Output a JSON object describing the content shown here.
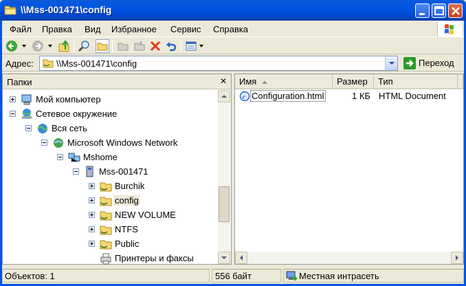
{
  "window": {
    "title": "\\\\Mss-001471\\config",
    "icons": [
      "folder-icon",
      "minimize-icon",
      "maximize-icon",
      "close-icon"
    ]
  },
  "menu": {
    "items": [
      "Файл",
      "Правка",
      "Вид",
      "Избранное",
      "Сервис",
      "Справка"
    ]
  },
  "toolbar": {
    "icons": [
      "back-icon",
      "forward-icon",
      "up-icon",
      "search-icon",
      "folders-icon",
      "move-to-icon",
      "copy-to-icon",
      "delete-icon",
      "undo-icon",
      "views-icon"
    ]
  },
  "address": {
    "label": "Адрес:",
    "value": "\\\\Mss-001471\\config",
    "go_label": "Переход"
  },
  "folders": {
    "title": "Папки",
    "items": [
      {
        "label": "Мой компьютер",
        "icon": "my-computer-icon",
        "expander": "plus"
      },
      {
        "label": "Сетевое окружение",
        "icon": "network-places-icon",
        "expander": "minus"
      },
      {
        "label": "Вся сеть",
        "icon": "entire-network-icon",
        "expander": "minus"
      },
      {
        "label": "Microsoft Windows Network",
        "icon": "windows-network-icon",
        "expander": "minus"
      },
      {
        "label": "Mshome",
        "icon": "workgroup-icon",
        "expander": "minus"
      },
      {
        "label": "Mss-001471",
        "icon": "computer-icon",
        "expander": "minus"
      },
      {
        "label": "Burchik",
        "icon": "share-folder-icon",
        "expander": "plus"
      },
      {
        "label": "config",
        "icon": "share-folder-icon",
        "expander": "plus",
        "selected": true
      },
      {
        "label": "NEW VOLUME",
        "icon": "share-folder-icon",
        "expander": "plus"
      },
      {
        "label": "NTFS",
        "icon": "share-folder-icon",
        "expander": "plus"
      },
      {
        "label": "Public",
        "icon": "share-folder-icon",
        "expander": "plus"
      },
      {
        "label": "Принтеры и факсы",
        "icon": "printers-icon",
        "expander": "none"
      }
    ]
  },
  "files": {
    "columns": [
      "Имя",
      "Размер",
      "Тип"
    ],
    "rows": [
      {
        "name": "Configuration.html",
        "size": "1 КБ",
        "type": "HTML Document",
        "icon": "html-file-icon"
      }
    ]
  },
  "status": {
    "objects": "Объектов: 1",
    "size": "556 байт",
    "zone": "Местная интрасеть"
  }
}
